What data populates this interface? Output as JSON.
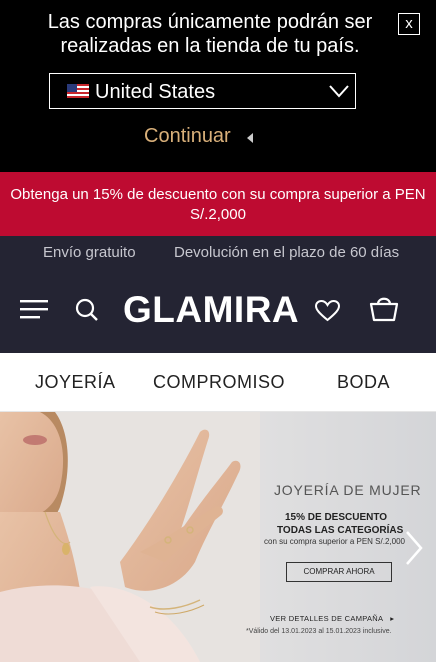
{
  "country_popup": {
    "message": "Las compras únicamente podrán ser realizadas en la tienda de tu país.",
    "close_label": "x",
    "country_selected": "United States",
    "flag_icon": "us-flag-icon",
    "continue_label": "Continuar"
  },
  "promo": {
    "text": "Obtenga un 15% de descuento con su compra superior a PEN S/.2,000",
    "background": "#be0b31"
  },
  "header": {
    "benefit_shipping": "Envío gratuito",
    "benefit_returns": "Devolución en el plazo de 60 días",
    "logo": "GLAMIRA",
    "background": "#242433"
  },
  "nav": {
    "items": [
      "JOYERÍA",
      "COMPROMISO",
      "BODA"
    ]
  },
  "hero": {
    "title": "JOYERÍA DE MUJER",
    "line1": "15% DE DESCUENTO",
    "line2": "TODAS LAS CATEGORÍAS",
    "line3": "con su compra superior a PEN S/.2,000",
    "cta": "COMPRAR AHORA",
    "campaign_link": "VER DETALLES DE CAMPAÑA",
    "validity": "*Válido del 13.01.2023 al 15.01.2023 inclusive."
  }
}
